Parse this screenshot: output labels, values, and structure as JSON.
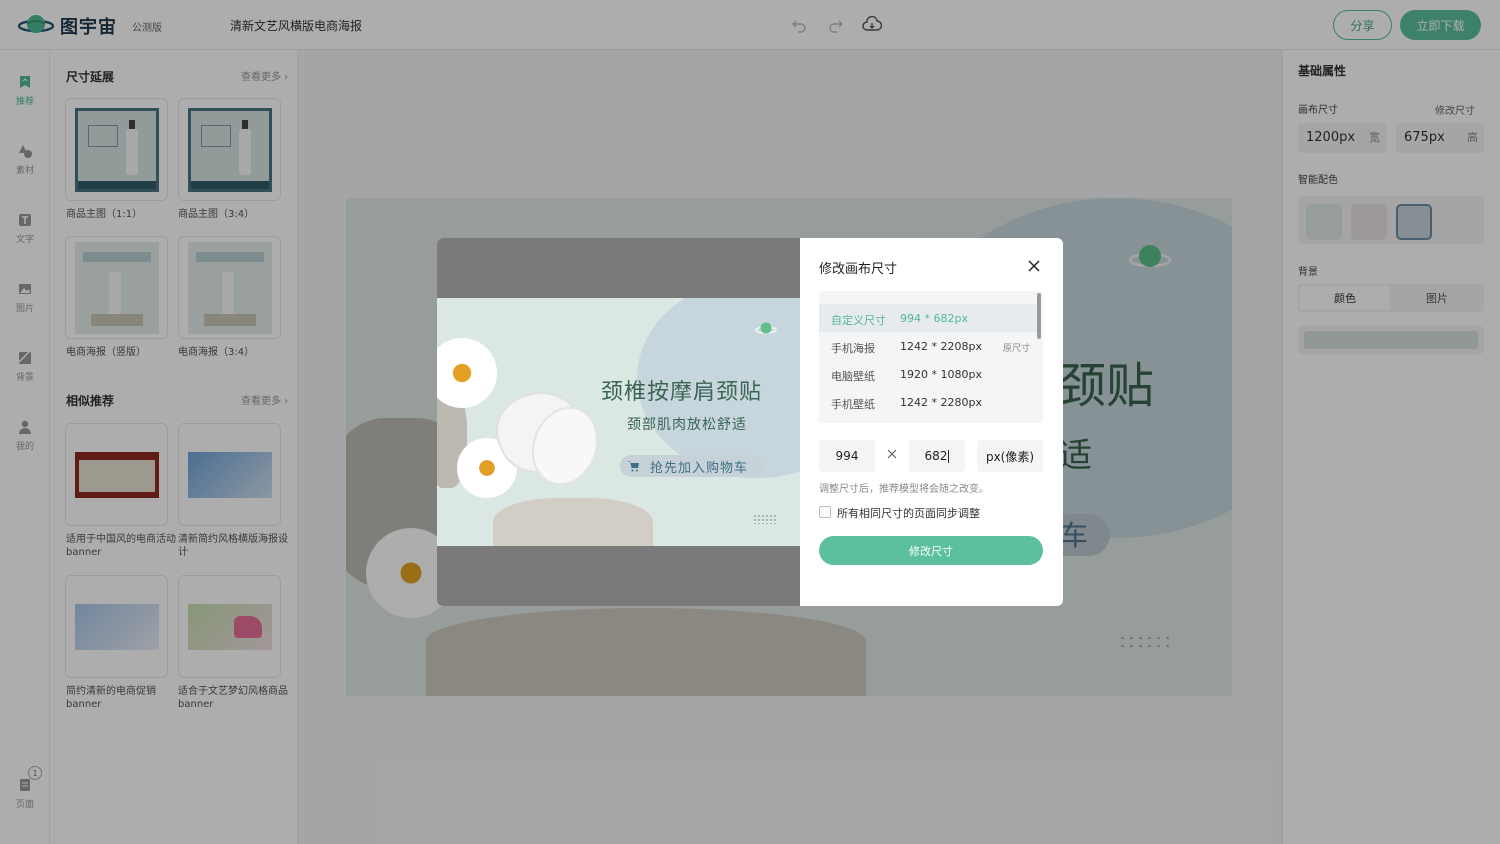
{
  "app": {
    "brand": "图宇宙",
    "beta_label": "公测版",
    "doc_title": "清新文艺风横版电商海报"
  },
  "toolbar": {
    "share_label": "分享",
    "download_label": "立即下载"
  },
  "rail": {
    "items": [
      {
        "label": "推荐"
      },
      {
        "label": "素材"
      },
      {
        "label": "文字"
      },
      {
        "label": "图片"
      },
      {
        "label": "背景"
      },
      {
        "label": "我的"
      }
    ],
    "pages_label": "页面",
    "pages_count": "1"
  },
  "left_panel": {
    "section1": {
      "title": "尺寸延展",
      "more": "查看更多",
      "items": [
        {
          "label": "商品主图（1:1）"
        },
        {
          "label": "商品主图（3:4）"
        },
        {
          "label": "电商海报（竖版）"
        },
        {
          "label": "电商海报（3:4）"
        }
      ]
    },
    "section2": {
      "title": "相似推荐",
      "more": "查看更多",
      "items": [
        {
          "label": "适用于中国风的电商活动banner"
        },
        {
          "label": "清新简约风格横版海报设计"
        },
        {
          "label": "简约清新的电商促销banner"
        },
        {
          "label": "适合于文艺梦幻风格商品banner"
        }
      ]
    }
  },
  "canvas": {
    "title_partial": "颈贴",
    "subtitle_partial": "适",
    "button_partial": "车"
  },
  "right_panel": {
    "title": "基础属性",
    "canvas_size_label": "画布尺寸",
    "modify_size_link": "修改尺寸",
    "width": {
      "value": "1200px",
      "unit": "宽"
    },
    "height": {
      "value": "675px",
      "unit": "高"
    },
    "smart_color_label": "智能配色",
    "swatches": [
      "#dfe9e4",
      "#e6e1e6",
      "#c9d3da"
    ],
    "background_label": "背景",
    "bg_tabs": [
      "颜色",
      "图片"
    ]
  },
  "dialog": {
    "title": "修改画布尺寸",
    "preview": {
      "title": "颈椎按摩肩颈贴",
      "subtitle": "颈部肌肉放松舒适",
      "button": "抢先加入购物车"
    },
    "sizes": [
      {
        "name": "自定义尺寸",
        "value": "994 * 682px",
        "tag": ""
      },
      {
        "name": "手机海报",
        "value": "1242 * 2208px",
        "tag": "原尺寸"
      },
      {
        "name": "电脑壁纸",
        "value": "1920 * 1080px",
        "tag": ""
      },
      {
        "name": "手机壁纸",
        "value": "1242 * 2280px",
        "tag": ""
      }
    ],
    "width_value": "994",
    "height_value": "682",
    "unit": "px(像素)",
    "hint": "调整尺寸后，推荐模型将会随之改变。",
    "sync_label": "所有相同尺寸的页面同步调整",
    "confirm_label": "修改尺寸"
  },
  "colors": {
    "accent": "#5cc09f",
    "accent_dark": "#4fb896",
    "brand_text": "#1f3a4d"
  }
}
